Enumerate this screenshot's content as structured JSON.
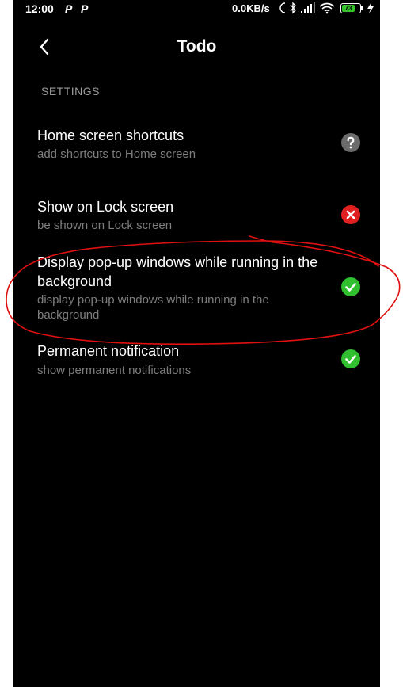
{
  "status_bar": {
    "time": "12:00",
    "notif_1": "P",
    "notif_2": "P",
    "net_speed": "0.0KB/s",
    "battery_level": "73"
  },
  "header": {
    "title": "Todo"
  },
  "section": {
    "label": "SETTINGS"
  },
  "settings": [
    {
      "title": "Home screen shortcuts",
      "subtitle": "add shortcuts to Home screen",
      "status": "unknown",
      "status_icon": "question-icon",
      "status_color": "#6b6b6b"
    },
    {
      "title": "Show on Lock screen",
      "subtitle": "be shown on Lock screen",
      "status": "denied",
      "status_icon": "cross-icon",
      "status_color": "#e02020"
    },
    {
      "title": "Display pop-up windows while running in the background",
      "subtitle": "display pop-up windows while running in the background",
      "status": "allowed",
      "status_icon": "check-icon",
      "status_color": "#2fbf2f"
    },
    {
      "title": "Permanent notification",
      "subtitle": "show permanent notifications",
      "status": "allowed",
      "status_icon": "check-icon",
      "status_color": "#2fbf2f"
    }
  ],
  "colors": {
    "background": "#000000",
    "annotation": "#e01010",
    "battery": "#37c42c"
  }
}
